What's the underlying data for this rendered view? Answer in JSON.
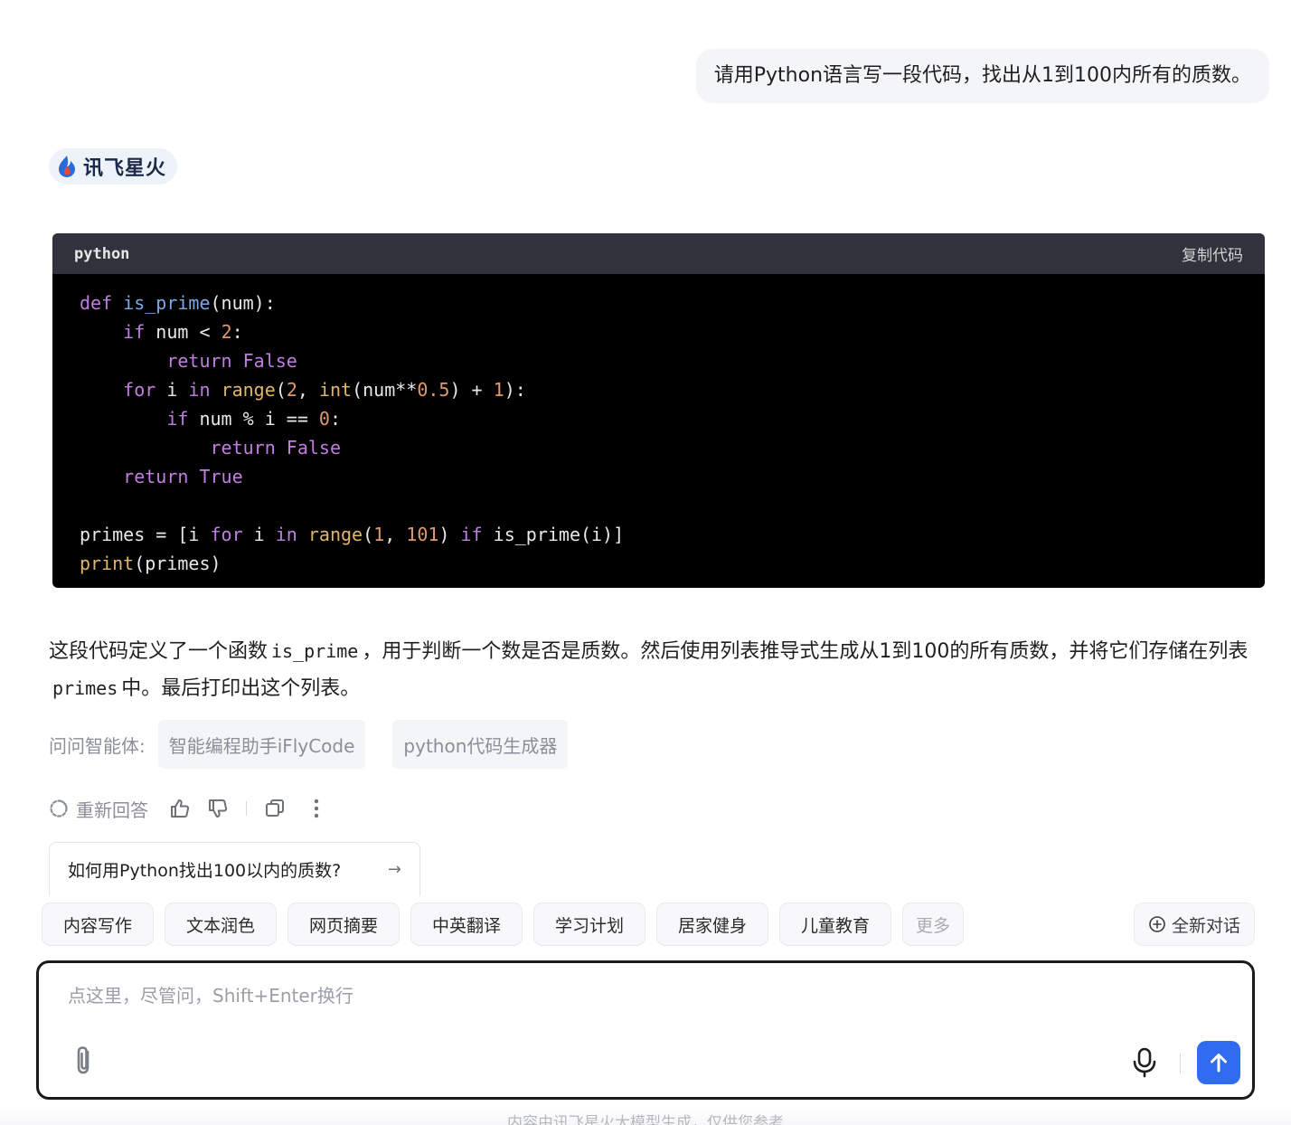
{
  "user_message": "请用Python语言写一段代码，找出从1到100内所有的质数。",
  "brand": {
    "name": "讯飞星火",
    "logo_icon": "spark-flame-icon"
  },
  "code_block": {
    "language": "python",
    "copy_label": "复制代码",
    "code": "def is_prime(num):\n    if num < 2:\n        return False\n    for i in range(2, int(num**0.5) + 1):\n        if num % i == 0:\n            return False\n    return True\n\nprimes = [i for i in range(1, 101) if is_prime(i)]\nprint(primes)"
  },
  "explanation": {
    "part1": "这段代码定义了一个函数",
    "code1": "is_prime",
    "part2": "，用于判断一个数是否是质数。然后使用列表推导式生成从1到100的所有质数，并将它们存储在列表",
    "code2": "primes",
    "part3": "中。最后打印出这个列表。"
  },
  "ask_agents": {
    "label": "问问智能体:",
    "agents": [
      "智能编程助手iFlyCode",
      "python代码生成器"
    ]
  },
  "actions": {
    "regenerate_label": "重新回答",
    "icons": [
      "refresh-icon",
      "thumbs-up-icon",
      "thumbs-down-icon",
      "copy-icon",
      "more-vertical-icon"
    ]
  },
  "suggestion": {
    "text": "如何用Python找出100以内的质数?",
    "arrow": "→"
  },
  "quick_chips": [
    "内容写作",
    "文本润色",
    "网页摘要",
    "中英翻译",
    "学习计划",
    "居家健身",
    "儿童教育",
    "更多"
  ],
  "new_chat_label": "全新对话",
  "input": {
    "placeholder": "点这里，尽管问，Shift+Enter换行",
    "value": ""
  },
  "footer_note": "内容由讯飞星火大模型生成，仅供您参考",
  "colors": {
    "accent": "#2f6cf0",
    "code_bg": "#000000",
    "code_header": "#31333c"
  }
}
